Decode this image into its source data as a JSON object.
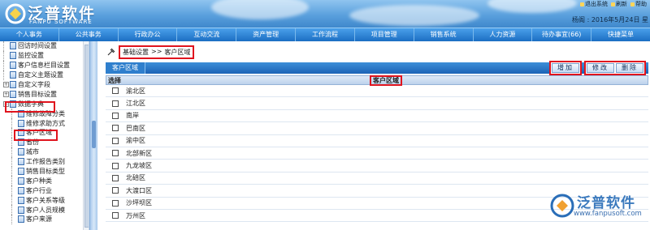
{
  "app": {
    "logo_title": "泛普软件",
    "logo_subtitle": "FANPU SOFTWARE",
    "header_tools": [
      "退出系统",
      "刷新",
      "帮助"
    ],
    "user_info": "杨阁 : 2016年5月24日 星"
  },
  "nav": {
    "items": [
      "个人事务",
      "公共事务",
      "行政办公",
      "互动交流",
      "资产管理",
      "工作流程",
      "项目管理",
      "销售系统",
      "人力资源",
      "待办事宜(66)",
      "快捷菜单"
    ]
  },
  "sidebar": {
    "items": [
      {
        "label": "回访时间设置"
      },
      {
        "label": "监控设置"
      },
      {
        "label": "客户信息栏目设置"
      },
      {
        "label": "自定义主题设置"
      },
      {
        "label": "自定义字段"
      },
      {
        "label": "销售目标设置"
      },
      {
        "label": "数据字典"
      },
      {
        "label": "维修故障分类"
      },
      {
        "label": "维修求助方式"
      },
      {
        "label": "客户区域"
      },
      {
        "label": "省份"
      },
      {
        "label": "城市"
      },
      {
        "label": "工作报告类别"
      },
      {
        "label": "销售目标类型"
      },
      {
        "label": "客户种类"
      },
      {
        "label": "客户行业"
      },
      {
        "label": "客户关系等级"
      },
      {
        "label": "客户人员规模"
      },
      {
        "label": "客户来源"
      }
    ]
  },
  "breadcrumb": {
    "parent": "基础设置",
    "separator": ">>",
    "current": "客户区域"
  },
  "toolbar": {
    "tab_label": "客户区域",
    "add_label": "增加",
    "edit_label": "修改",
    "delete_label": "删除"
  },
  "grid": {
    "col_select": "选择",
    "col_name": "客户区域",
    "rows": [
      "渝北区",
      "江北区",
      "南岸",
      "巴南区",
      "渝中区",
      "北部新区",
      "九龙坡区",
      "北碚区",
      "大渡口区",
      "沙坪坝区",
      "万州区"
    ]
  },
  "watermark": {
    "title": "泛普软件",
    "url": "www.fanpusoft.com"
  },
  "colors": {
    "nav_bar": "#1c6ec3",
    "highlight_box": "#e0141e",
    "brand": "#2a6eb8"
  }
}
